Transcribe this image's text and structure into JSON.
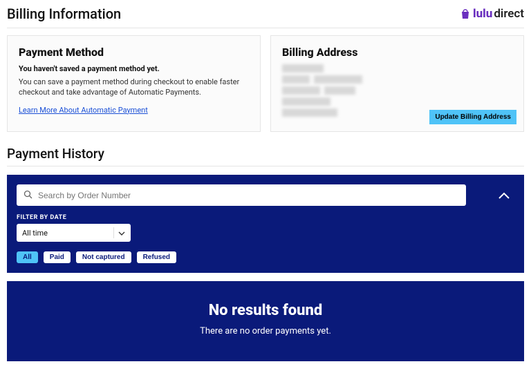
{
  "header": {
    "title": "Billing Information",
    "logo": {
      "brand": "lulu",
      "suffix": "direct"
    }
  },
  "payment_method": {
    "heading": "Payment Method",
    "not_saved": "You haven't saved a payment method yet.",
    "description": "You can save a payment method during checkout to enable faster checkout and take advantage of Automatic Payments.",
    "learn_more": "Learn More About Automatic Payment"
  },
  "billing_address": {
    "heading": "Billing Address",
    "update_label": "Update Billing Address"
  },
  "payment_history": {
    "heading": "Payment History",
    "search_placeholder": "Search by Order Number",
    "filter_by_date_label": "FILTER BY DATE",
    "date_value": "All time",
    "chips": [
      "All",
      "Paid",
      "Not captured",
      "Refused"
    ],
    "active_chip": 0,
    "no_results_title": "No results found",
    "no_results_sub": "There are no order payments yet."
  }
}
